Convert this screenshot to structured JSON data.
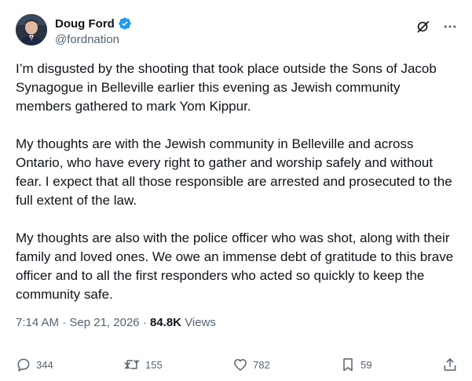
{
  "author": {
    "display_name": "Doug Ford",
    "handle": "@fordnation",
    "verified": true,
    "verified_color": "#1d9bf0"
  },
  "top_actions": {
    "grok_icon": "grok-icon",
    "more_icon": "more-icon"
  },
  "tweet": {
    "paragraphs": [
      "I’m disgusted by the shooting that took place outside the Sons of Jacob Synagogue in Belleville earlier this evening as Jewish community members gathered to mark Yom Kippur.",
      "My thoughts are with the Jewish community in Belleville and across Ontario, who have every right to gather and worship safely and without fear. I expect that all those responsible are arrested and prosecuted to the full extent of the law.",
      "My thoughts are also with the police officer who was shot, along with their family and loved ones. We owe an immense debt of gratitude to this brave officer and to all the first responders who acted so quickly to keep the community safe."
    ]
  },
  "meta": {
    "time": "7:14 AM",
    "separator": "·",
    "date": "Sep 21, 2026",
    "views_count": "84.8K",
    "views_label": "Views"
  },
  "actions": {
    "replies": "344",
    "reposts": "155",
    "likes": "782",
    "bookmarks": "59"
  },
  "colors": {
    "text": "#0f1419",
    "secondary": "#536471",
    "accent": "#1d9bf0"
  }
}
